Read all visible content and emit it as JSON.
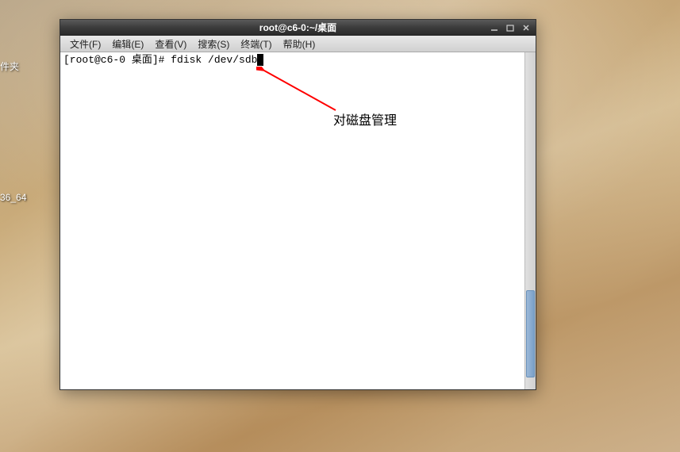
{
  "desktop": {
    "icon_label_1": "件夹",
    "icon_label_2": "36_64"
  },
  "window": {
    "title": "root@c6-0:~/桌面"
  },
  "menubar": {
    "items": [
      "文件(F)",
      "编辑(E)",
      "查看(V)",
      "搜索(S)",
      "终端(T)",
      "帮助(H)"
    ]
  },
  "terminal": {
    "prompt": "[root@c6-0 桌面]# ",
    "command": "fdisk /dev/sdb"
  },
  "annotation": {
    "text": "对磁盘管理"
  }
}
